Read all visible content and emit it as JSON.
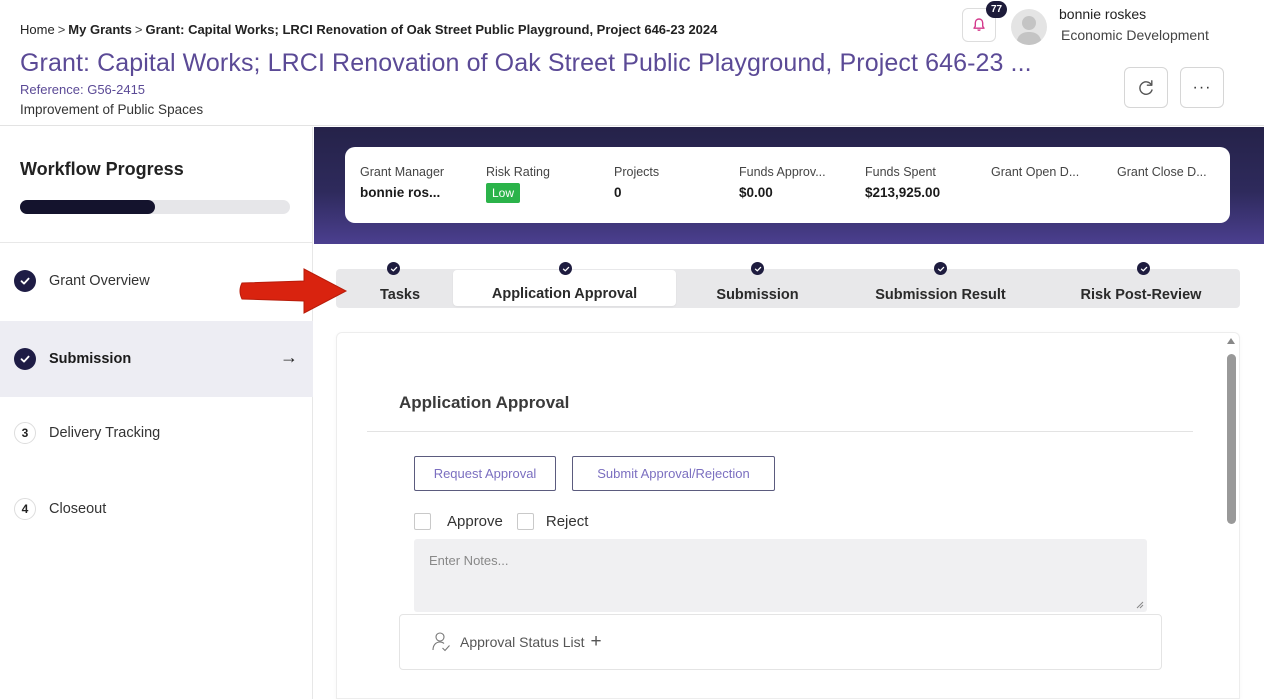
{
  "breadcrumb": {
    "home": "Home",
    "sep1": ">",
    "my_grants": "My Grants",
    "sep2": ">",
    "current": "Grant: Capital Works; LRCI Renovation of Oak Street Public Playground, Project 646-23 2024"
  },
  "header": {
    "title": "Grant: Capital Works; LRCI Renovation of Oak Street Public Playground, Project 646-23 ...",
    "reference": "Reference: G56-2415",
    "program": "Improvement of Public Spaces",
    "notification_count": "77",
    "user_name": "bonnie roskes",
    "user_department": "Economic Development",
    "more_label": "···"
  },
  "sidebar": {
    "workflow_title": "Workflow Progress",
    "workflow_progress_fraction": 0.5,
    "steps": [
      {
        "label": "Grant Overview",
        "number": "",
        "status": "done"
      },
      {
        "label": "Submission",
        "number": "",
        "status": "active",
        "arrow": "→"
      },
      {
        "label": "Delivery Tracking",
        "number": "3",
        "status": "pending"
      },
      {
        "label": "Closeout",
        "number": "4",
        "status": "pending"
      }
    ]
  },
  "summary": {
    "grant_manager_label": "Grant Manager",
    "grant_manager_value": "bonnie ros...",
    "risk_rating_label": "Risk Rating",
    "risk_rating_value": "Low",
    "projects_label": "Projects",
    "projects_value": "0",
    "funds_approved_label": "Funds Approv...",
    "funds_approved_value": "$0.00",
    "funds_spent_label": "Funds Spent",
    "funds_spent_value": "$213,925.00",
    "grant_open_label": "Grant Open D...",
    "grant_close_label": "Grant Close D..."
  },
  "tabs": [
    {
      "label": "Tasks",
      "active": false
    },
    {
      "label": "Application Approval",
      "active": true
    },
    {
      "label": "Submission",
      "active": false
    },
    {
      "label": "Submission Result",
      "active": false
    },
    {
      "label": "Risk Post-Review",
      "active": false
    }
  ],
  "approval": {
    "title": "Application Approval",
    "request_button": "Request Approval",
    "submit_button": "Submit Approval/Rejection",
    "approve_label": "Approve",
    "reject_label": "Reject",
    "notes_placeholder": "Enter Notes...",
    "status_list_label": "Approval Status List",
    "status_list_plus": "+"
  },
  "colors": {
    "accent_purple": "#5b4a96",
    "dark_navy": "#1e1c45",
    "banner_dark": "#252249",
    "risk_low_green": "#2bb34a",
    "annotation_red": "#d9230f"
  },
  "icons": {
    "notification": "bell-icon",
    "avatar": "user-avatar-icon",
    "refresh": "refresh-icon",
    "more": "ellipsis-icon",
    "step_done": "check-circle-icon",
    "status_list": "person-icon"
  }
}
